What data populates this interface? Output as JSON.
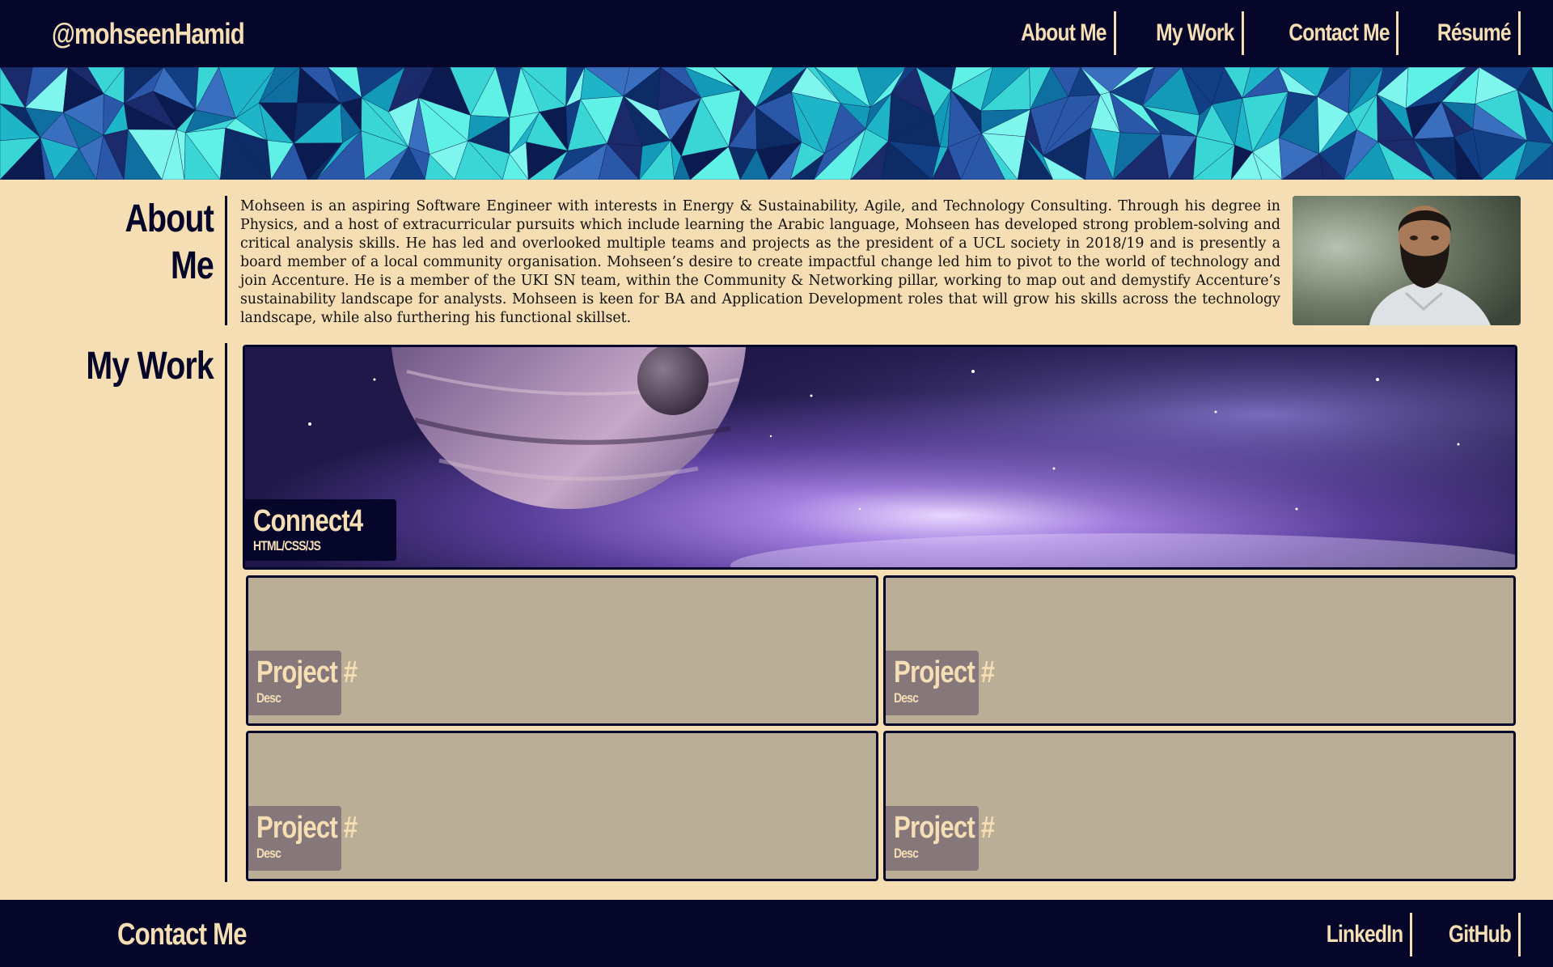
{
  "header": {
    "brand": "@mohseenHamid",
    "nav": [
      "About Me",
      "My Work",
      "Contact Me",
      "Résumé"
    ]
  },
  "about": {
    "title": "About Me",
    "text": "Mohseen is an aspiring Software Engineer with interests in Energy & Sustainability, Agile, and Technology Consulting. Through his degree in Physics, and a host of extracurricular pursuits which include learning the Arabic language, Mohseen has developed strong problem-solving and critical analysis skills. He has led and overlooked multiple teams and projects as the president of a UCL society in 2018/19 and is presently a board member of a local community organisation. Mohseen’s desire to create impactful change led him to pivot to the world of technology and join Accenture. He is a member of the UKI SN team, within the Community & Networking pillar, working to map out and demystify Accenture’s sustainability landscape for analysts. Mohseen is keen for BA and Application Development roles that will grow his skills across the technology landscape, while also furthering his functional skillset."
  },
  "work": {
    "title": "My Work",
    "featured": {
      "title": "Connect4",
      "subtitle": "HTML/CSS/JS"
    },
    "projects": [
      {
        "title": "Project #",
        "desc": "Desc"
      },
      {
        "title": "Project #",
        "desc": "Desc"
      },
      {
        "title": "Project #",
        "desc": "Desc"
      },
      {
        "title": "Project #",
        "desc": "Desc"
      }
    ]
  },
  "footer": {
    "title": "Contact Me",
    "links": [
      "LinkedIn",
      "GitHub"
    ]
  },
  "colors": {
    "navy": "#06062a",
    "wheat": "#f5deb3",
    "tile": "#baae97",
    "tile_caption": "#85777a"
  }
}
